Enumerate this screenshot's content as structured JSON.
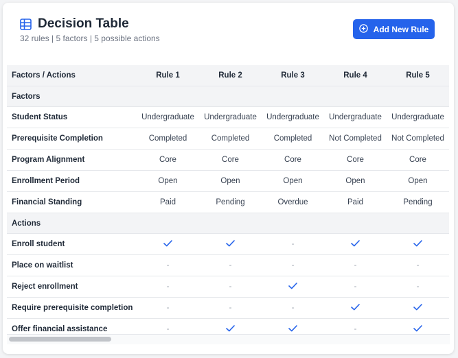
{
  "header": {
    "title": "Decision Table",
    "subtitle": "32 rules | 5 factors | 5 possible actions",
    "add_button_label": "Add New Rule",
    "icon": "table-icon"
  },
  "colors": {
    "accent": "#2563eb",
    "header_bg": "#f3f4f6",
    "check": "#2563eb"
  },
  "table": {
    "corner_label": "Factors / Actions",
    "rules": [
      "Rule 1",
      "Rule 2",
      "Rule 3",
      "Rule 4",
      "Rule 5"
    ],
    "factors_heading": "Factors",
    "factors": [
      {
        "label": "Student Status",
        "values": [
          "Undergraduate",
          "Undergraduate",
          "Undergraduate",
          "Undergraduate",
          "Undergraduate"
        ]
      },
      {
        "label": "Prerequisite Completion",
        "values": [
          "Completed",
          "Completed",
          "Completed",
          "Not Completed",
          "Not Completed"
        ]
      },
      {
        "label": "Program Alignment",
        "values": [
          "Core",
          "Core",
          "Core",
          "Core",
          "Core"
        ]
      },
      {
        "label": "Enrollment Period",
        "values": [
          "Open",
          "Open",
          "Open",
          "Open",
          "Open"
        ]
      },
      {
        "label": "Financial Standing",
        "values": [
          "Paid",
          "Pending",
          "Overdue",
          "Paid",
          "Pending"
        ]
      }
    ],
    "actions_heading": "Actions",
    "dash_symbol": "-",
    "actions": [
      {
        "label": "Enroll student",
        "values": [
          true,
          true,
          false,
          true,
          true
        ]
      },
      {
        "label": "Place on waitlist",
        "values": [
          false,
          false,
          false,
          false,
          false
        ]
      },
      {
        "label": "Reject enrollment",
        "values": [
          false,
          false,
          true,
          false,
          false
        ]
      },
      {
        "label": "Require prerequisite completion",
        "values": [
          false,
          false,
          false,
          true,
          true
        ]
      },
      {
        "label": "Offer financial assistance",
        "values": [
          false,
          true,
          true,
          false,
          true
        ]
      }
    ]
  }
}
